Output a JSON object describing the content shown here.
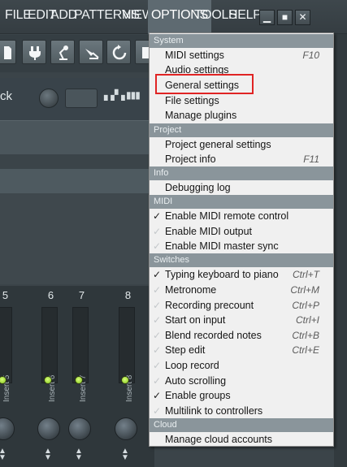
{
  "menubar": {
    "items": [
      {
        "label": "FILE"
      },
      {
        "label": "EDIT"
      },
      {
        "label": "ADD"
      },
      {
        "label": "PATTERNS"
      },
      {
        "label": "VIEW"
      },
      {
        "label": "OPTIONS"
      },
      {
        "label": "TOOLS"
      },
      {
        "label": "HELP"
      }
    ],
    "window_buttons": {
      "minimize": "▁",
      "maximize": "■",
      "close": "✕"
    }
  },
  "background": {
    "control_label": "ck",
    "mixer_channels": [
      {
        "number": "5",
        "label": "Insert 5"
      },
      {
        "number": "6",
        "label": "Insert 6"
      },
      {
        "number": "7",
        "label": "Insert 7"
      },
      {
        "number": "8",
        "label": "Insert 8"
      }
    ]
  },
  "options_menu": {
    "sections": [
      {
        "header": "System",
        "items": [
          {
            "label": "MIDI settings",
            "shortcut": "F10"
          },
          {
            "label": "Audio settings",
            "shortcut": ""
          },
          {
            "label": "General settings",
            "shortcut": ""
          },
          {
            "label": "File settings",
            "shortcut": ""
          },
          {
            "label": "Manage plugins",
            "shortcut": ""
          }
        ]
      },
      {
        "header": "Project",
        "items": [
          {
            "label": "Project general settings",
            "shortcut": ""
          },
          {
            "label": "Project info",
            "shortcut": "F11"
          }
        ]
      },
      {
        "header": "Info",
        "items": [
          {
            "label": "Debugging log",
            "shortcut": ""
          }
        ]
      },
      {
        "header": "MIDI",
        "items": [
          {
            "label": "Enable MIDI remote control",
            "checked": true
          },
          {
            "label": "Enable MIDI output",
            "checked": false
          },
          {
            "label": "Enable MIDI master sync",
            "checked": false
          }
        ]
      },
      {
        "header": "Switches",
        "items": [
          {
            "label": "Typing keyboard to piano",
            "shortcut": "Ctrl+T",
            "checked": true
          },
          {
            "label": "Metronome",
            "shortcut": "Ctrl+M",
            "checked": false
          },
          {
            "label": "Recording precount",
            "shortcut": "Ctrl+P",
            "checked": false
          },
          {
            "label": "Start on input",
            "shortcut": "Ctrl+I",
            "checked": false
          },
          {
            "label": "Blend recorded notes",
            "shortcut": "Ctrl+B",
            "checked": false
          },
          {
            "label": "Step edit",
            "shortcut": "Ctrl+E",
            "checked": false
          },
          {
            "label": "Loop record",
            "shortcut": "",
            "checked": false
          },
          {
            "label": "Auto scrolling",
            "shortcut": "",
            "checked": false
          },
          {
            "label": "Enable groups",
            "shortcut": "",
            "checked": true
          },
          {
            "label": "Multilink to controllers",
            "shortcut": "",
            "checked": false
          }
        ]
      },
      {
        "header": "Cloud",
        "items": [
          {
            "label": "Manage cloud accounts",
            "shortcut": ""
          }
        ]
      }
    ]
  },
  "colors": {
    "highlight": "#e02424",
    "section_header": "#8a959b",
    "menu_background": "#f0f0f0",
    "active_menu": "#5e6a71",
    "led_green": "#9fe02a"
  }
}
